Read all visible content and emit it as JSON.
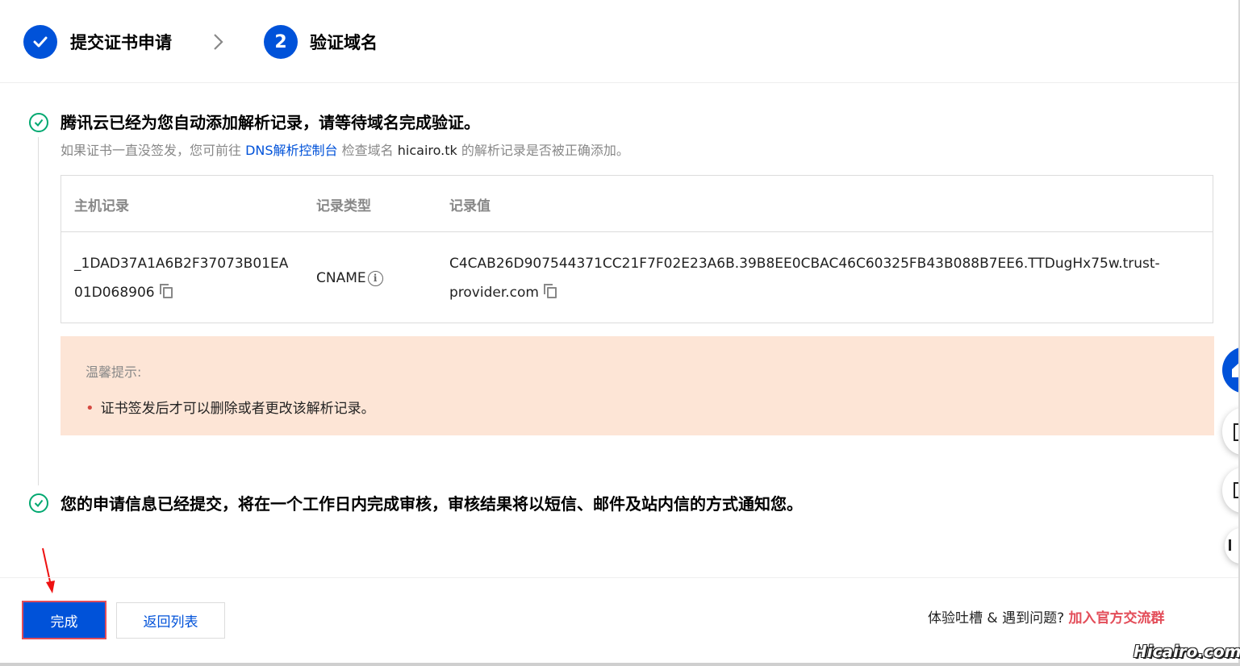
{
  "steps": [
    {
      "state": "done",
      "label": "提交证书申请"
    },
    {
      "number": "2",
      "label": "验证域名"
    }
  ],
  "section1": {
    "title": "腾讯云已经为您自动添加解析记录，请等待域名完成验证。",
    "sub_prefix": "如果证书一直没签发，您可前往",
    "sub_link": "DNS解析控制台",
    "sub_mid": "检查域名",
    "sub_domain": "hicairo.tk",
    "sub_suffix": "的解析记录是否被正确添加。"
  },
  "table": {
    "headers": [
      "主机记录",
      "记录类型",
      "记录值"
    ],
    "row": {
      "host_line1": "_1DAD37A1A6B2F37073B01EA",
      "host_line2": "01D068906",
      "type": "CNAME",
      "value_line1": "C4CAB26D907544371CC21F7F02E23A6B.39B8EE0CBAC46C60325FB43B088B7EE6.TTDugHx75w.trust-",
      "value_line2": "provider.com"
    }
  },
  "tips": {
    "title": "温馨提示:",
    "items": [
      "证书签发后才可以删除或者更改该解析记录。"
    ]
  },
  "section2": {
    "title": "您的申请信息已经提交，将在一个工作日内完成审核，审核结果将以短信、邮件及站内信的方式通知您。"
  },
  "footer": {
    "done_button": "完成",
    "back_button": "返回列表",
    "feedback_text": "体验吐槽 & 遇到问题?",
    "feedback_link": "加入官方交流群"
  },
  "watermark": "Hicairo.com",
  "colors": {
    "primary": "#0052d9",
    "success": "#00a870",
    "danger": "#e34d59",
    "tips_bg": "#fde5d6"
  },
  "icons": [
    "check-icon",
    "chevron-right-icon",
    "success-circle-icon",
    "copy-icon",
    "info-icon",
    "arrow-annotation"
  ]
}
